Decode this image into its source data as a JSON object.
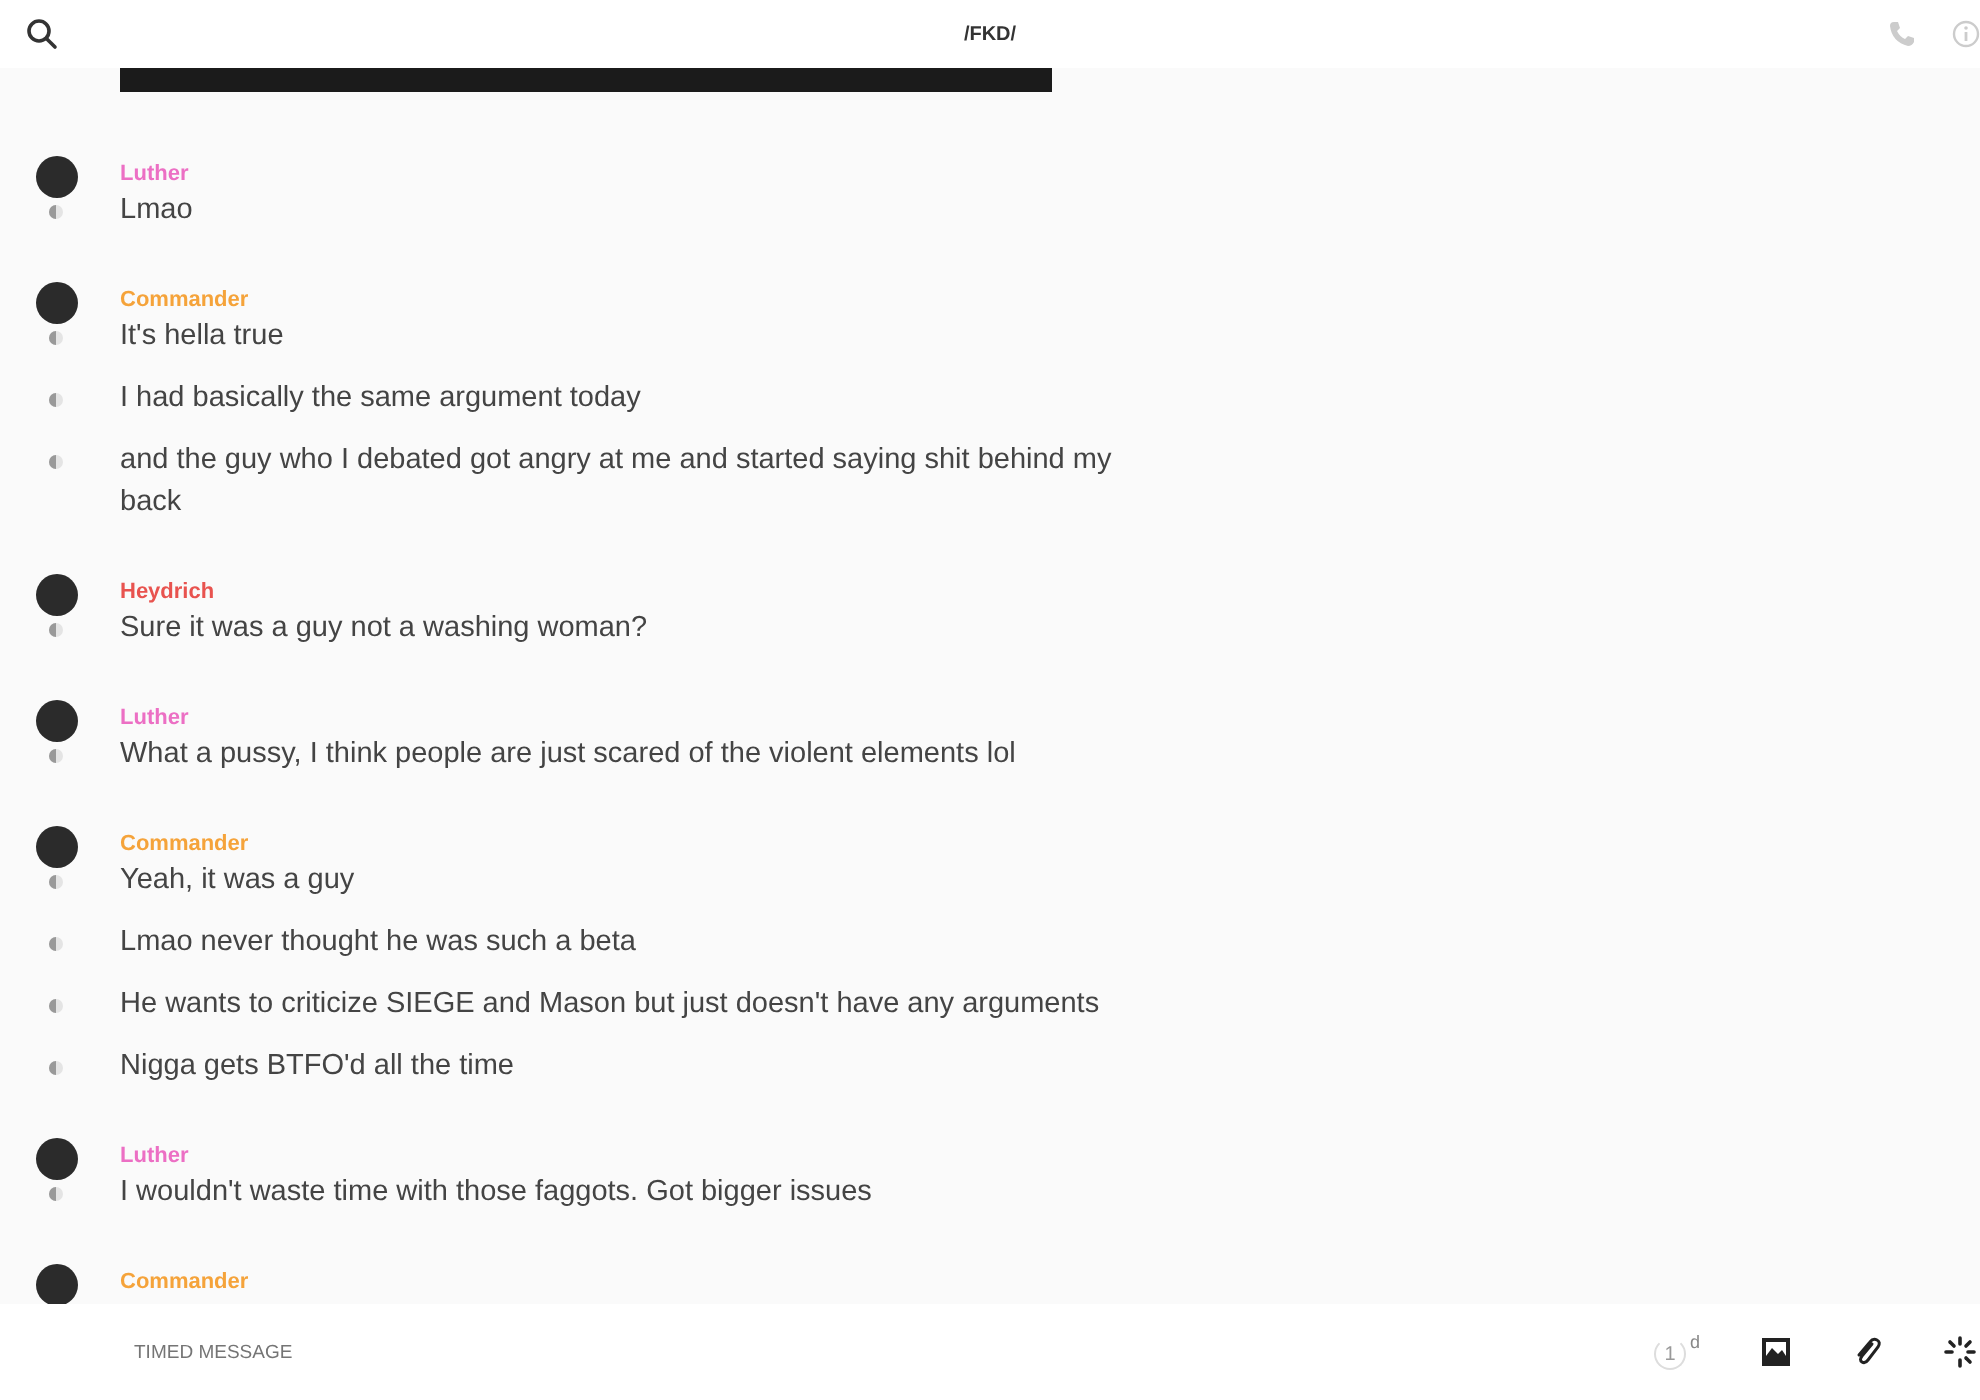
{
  "header": {
    "title": "/FKD/"
  },
  "groups": [
    {
      "author": "Luther",
      "color": "#ec6fc4",
      "messages": [
        "Lmao"
      ]
    },
    {
      "author": "Commander",
      "color": "#f5a33a",
      "messages": [
        "It's hella true",
        "I had basically the same argument today",
        "and the guy who I debated got angry at me and started saying shit behind my back"
      ]
    },
    {
      "author": "Heydrich",
      "color": "#e8534f",
      "messages": [
        "Sure it was a guy not a washing woman?"
      ]
    },
    {
      "author": "Luther",
      "color": "#ec6fc4",
      "messages": [
        "What a pussy, I think people are just scared of the violent elements lol"
      ]
    },
    {
      "author": "Commander",
      "color": "#f5a33a",
      "messages": [
        "Yeah, it was a guy",
        "Lmao never thought he was such a beta",
        "He wants to criticize SIEGE and Mason but just doesn't have any arguments",
        "Nigga gets BTFO'd all the time"
      ]
    },
    {
      "author": "Luther",
      "color": "#ec6fc4",
      "messages": [
        "I wouldn't waste time with those faggots. Got bigger issues"
      ]
    },
    {
      "author": "Commander",
      "color": "#f5a33a"
    }
  ],
  "composer": {
    "placeholder": "TIMED MESSAGE",
    "timer": "1",
    "timer_unit": "d"
  }
}
